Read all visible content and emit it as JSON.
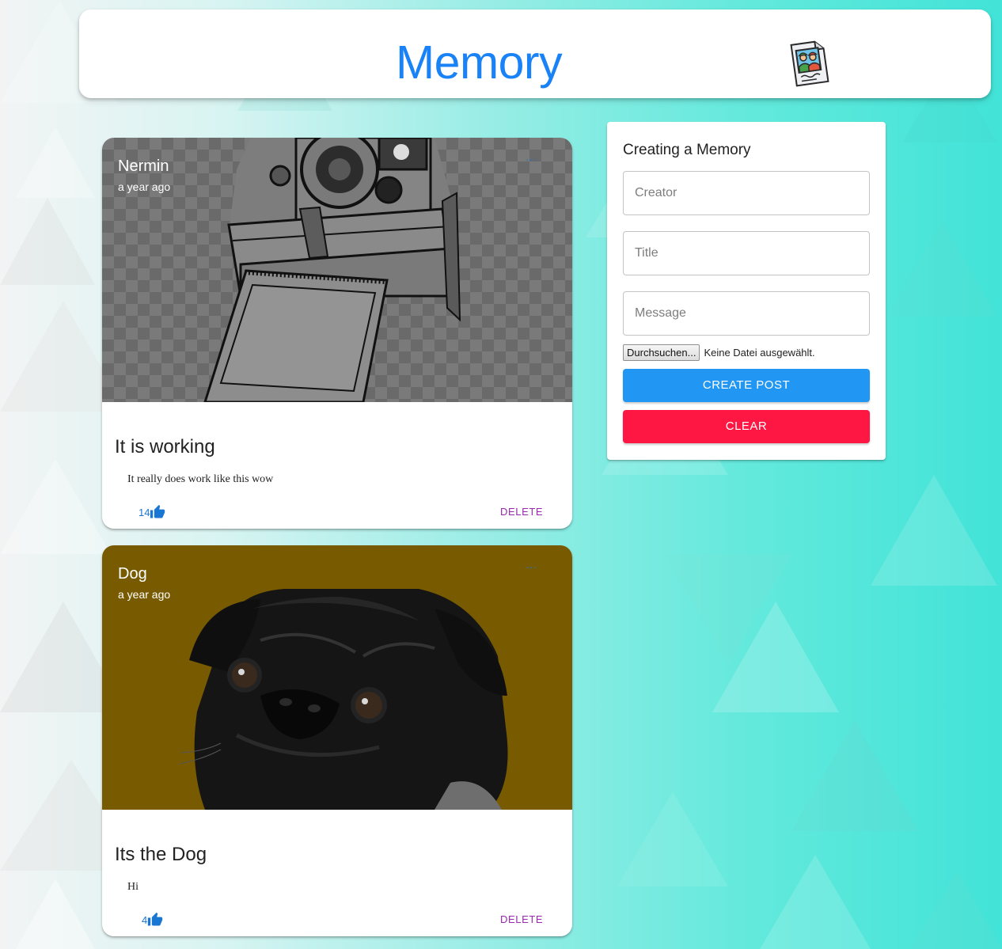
{
  "appbar": {
    "title": "Memory",
    "logo_icon": "photo-memory-icon"
  },
  "posts": [
    {
      "creator": "Nermin",
      "time": "a year ago",
      "title": "It is working",
      "message": "It really does work like this wow",
      "likes": "14",
      "delete_label": "DELETE",
      "image": "polaroid-camera-sketch"
    },
    {
      "creator": "Dog",
      "time": "a year ago",
      "title": "Its the Dog",
      "message": "Hi",
      "likes": "4",
      "delete_label": "DELETE",
      "image": "black-pug-photo"
    }
  ],
  "form": {
    "heading": "Creating a Memory",
    "creator_placeholder": "Creator",
    "title_placeholder": "Title",
    "message_placeholder": "Message",
    "file_button": "Durchsuchen...",
    "file_status": "Keine Datei ausgewählt.",
    "create_label": "CREATE POST",
    "clear_label": "CLEAR"
  },
  "colors": {
    "brand": "#1a82f7",
    "like": "#1976d2",
    "delete": "#9c27b0",
    "create_button": "#2196f3",
    "clear_button": "#ff1744"
  }
}
